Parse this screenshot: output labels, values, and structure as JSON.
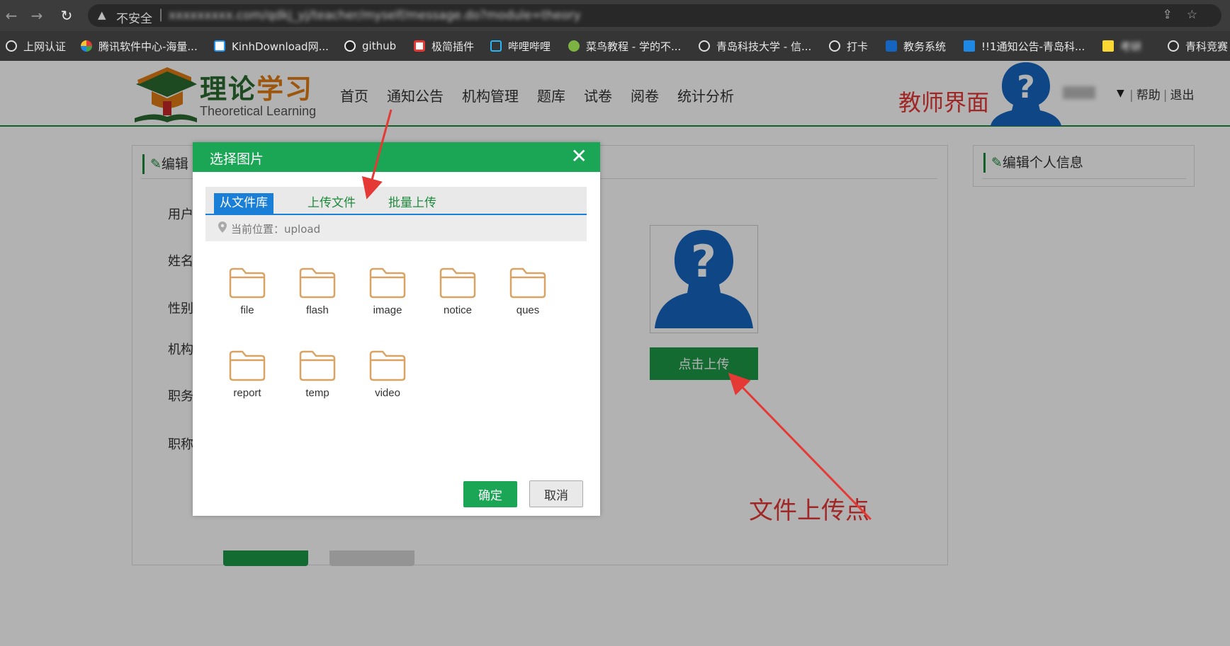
{
  "browser": {
    "insecure_label": "不安全",
    "url": "xxxxxxxxx.com/qdkj_yj/teacher/myself/message.do?module=theory",
    "bookmarks": [
      {
        "label": "上网认证",
        "icon": "globe-icon"
      },
      {
        "label": "腾讯软件中心-海量...",
        "icon": "tencent-icon"
      },
      {
        "label": "KinhDownload网...",
        "icon": "kinh-icon"
      },
      {
        "label": "github",
        "icon": "github-icon"
      },
      {
        "label": "极简插件",
        "icon": "plugin-icon"
      },
      {
        "label": "哔哩哔哩",
        "icon": "bilibili-icon"
      },
      {
        "label": "菜鸟教程 - 学的不...",
        "icon": "runoob-icon"
      },
      {
        "label": "青岛科技大学 - 信...",
        "icon": "globe-icon"
      },
      {
        "label": "打卡",
        "icon": "globe-icon"
      },
      {
        "label": "教务系统",
        "icon": "jiaowu-icon"
      },
      {
        "label": "!!1通知公告-青岛科...",
        "icon": "notice-icon"
      },
      {
        "label": "考研",
        "icon": "folder-icon"
      },
      {
        "label": "青科竞赛",
        "icon": "globe-icon"
      }
    ]
  },
  "site": {
    "logo_cn_a": "理论",
    "logo_cn_b": "学习",
    "logo_en": "Theoretical Learning",
    "nav": [
      "首页",
      "通知公告",
      "机构管理",
      "题库",
      "试卷",
      "阅卷",
      "统计分析"
    ],
    "user_name": "用户",
    "help": "帮助",
    "logout": "退出"
  },
  "annotations": {
    "teacher_page": "教师界面",
    "upload_point": "文件上传点"
  },
  "edit_panel": {
    "title": "编辑",
    "labels": [
      "用户",
      "姓名",
      "性别",
      "机构",
      "职务",
      "职称"
    ],
    "upload_button": "点击上传"
  },
  "side_panel": {
    "title": "编辑个人信息"
  },
  "modal": {
    "title": "选择图片",
    "tabs": [
      "从文件库",
      "上传文件",
      "批量上传"
    ],
    "location": "当前位置：upload",
    "folders": [
      "file",
      "flash",
      "image",
      "notice",
      "ques",
      "report",
      "temp",
      "video"
    ],
    "ok": "确定",
    "cancel": "取消"
  },
  "colors": {
    "primary_green": "#1aa654",
    "tab_blue": "#1a7fd6",
    "annotation_red": "#e53935",
    "folder_orange": "#d9a463"
  }
}
